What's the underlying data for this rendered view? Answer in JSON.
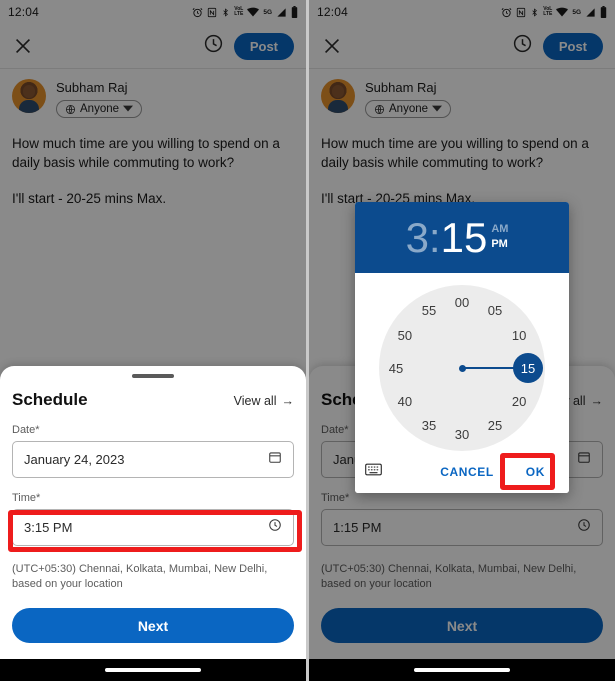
{
  "meta": {
    "accent_blue": "#0a66c2",
    "dialog_blue": "#0c4b8e",
    "highlight_red": "#ee1c1c"
  },
  "status_bar": {
    "time": "12:04",
    "icons": [
      "alarm-icon",
      "nfc-icon",
      "bluetooth-icon",
      "volte-icon",
      "wifi-icon",
      "network-5g-icon",
      "signal-icon",
      "battery-icon"
    ],
    "network_label": "5G",
    "volte_label_top": "VoL",
    "volte_label_bottom": "LTE"
  },
  "composer": {
    "close_label": "✕",
    "clock_icon": "clock-icon",
    "post_label": "Post",
    "author": {
      "name": "Subham Raj",
      "audience_label": "Anyone",
      "audience_icon": "globe-icon",
      "dropdown_icon": "caret-down-icon"
    },
    "post_text_line1": "How much time are you willing to spend on a",
    "post_text_line2": "daily basis while commuting to work?",
    "post_text_line3": "I'll start - 20-25 mins Max."
  },
  "sheet": {
    "title": "Schedule",
    "view_all_label": "View all",
    "view_all_arrow": "→",
    "date_label": "Date*",
    "date_value": "January 24, 2023",
    "date_icon": "calendar-icon",
    "time_label": "Time*",
    "time_value_left": "3:15 PM",
    "time_value_right": "1:15 PM",
    "time_icon": "clock-icon",
    "timezone_note": "(UTC+05:30) Chennai, Kolkata, Mumbai, New Delhi, based on your location",
    "next_label": "Next"
  },
  "time_picker": {
    "hour": "3",
    "separator": ":",
    "minute": "15",
    "am_label": "AM",
    "pm_label": "PM",
    "selected_period": "PM",
    "selected_field": "minute",
    "dial_numbers": [
      "00",
      "05",
      "10",
      "15",
      "20",
      "25",
      "30",
      "35",
      "40",
      "45",
      "50",
      "55"
    ],
    "selected_minute": "15",
    "keyboard_icon": "keyboard-icon",
    "cancel_label": "CANCEL",
    "ok_label": "OK"
  },
  "annotations": {
    "left_highlight_target": "time-field",
    "right_highlight_target": "ok-button"
  }
}
